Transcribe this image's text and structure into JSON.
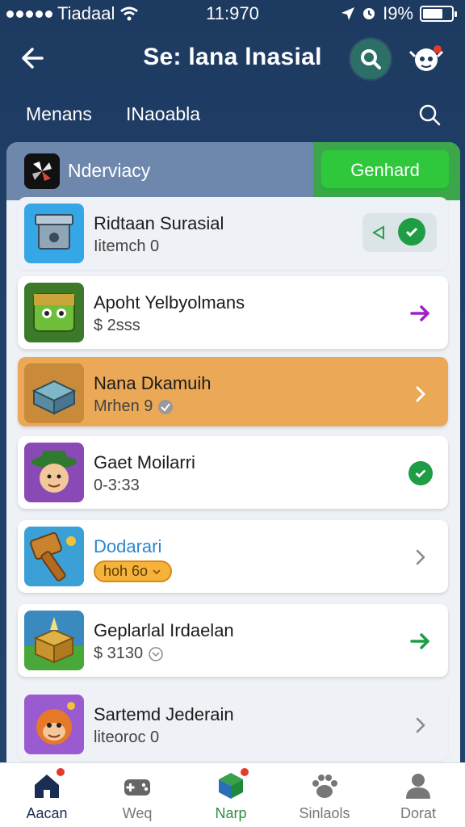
{
  "status_bar": {
    "carrier": "Tiadaal",
    "time": "11:970",
    "battery": "I9%",
    "battery_level": 0.7
  },
  "header": {
    "title": "Se: lana lnasial"
  },
  "subnav": {
    "tabs": [
      "Menans",
      "INaoabla"
    ]
  },
  "featured": {
    "name": "Nderviacy",
    "button_label": "Genhard"
  },
  "apps": [
    {
      "title": "Ridtaan Surasial",
      "subtitle": "Iitemch 0",
      "action": "toggle-check"
    },
    {
      "title": "Apoht Yelbyolmans",
      "subtitle": "$ 2sss",
      "action": "arrow-purple"
    },
    {
      "title": "Nana Dkamuih",
      "subtitle": "Mrhen 9",
      "action": "chevron-white"
    },
    {
      "title": "Gaet Moilarri",
      "subtitle": "0-3:33",
      "action": "check-green"
    },
    {
      "title": "Dodarari",
      "subtitle": "hoh 6o",
      "action": "chevron-gray"
    },
    {
      "title": "Geplarlal Irdaelan",
      "subtitle": "$ 3130",
      "action": "arrow-green"
    },
    {
      "title": "Sartemd Jederain",
      "subtitle": "liteoroc 0",
      "action": "chevron-gray"
    }
  ],
  "bottom_nav": [
    {
      "label": "Aacan",
      "icon": "home-icon"
    },
    {
      "label": "Weq",
      "icon": "gamepad-icon"
    },
    {
      "label": "Narp",
      "icon": "cube-icon"
    },
    {
      "label": "Sinlaols",
      "icon": "paw-icon"
    },
    {
      "label": "Dorat",
      "icon": "person-icon"
    }
  ],
  "colors": {
    "header_bg": "#1d3a60",
    "accent_green": "#2fc73c",
    "highlight_orange": "#eba857",
    "purple_arrow": "#a020c8"
  }
}
